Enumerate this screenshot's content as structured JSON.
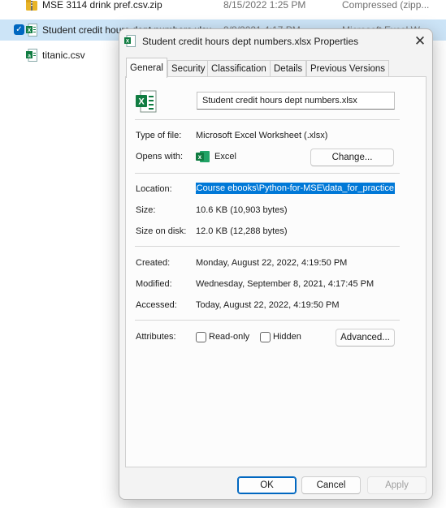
{
  "explorer": {
    "files": [
      {
        "name": "MSE 3114 drink pref.csv.zip",
        "date": "8/15/2022 1:25 PM",
        "type": "Compressed (zipp..."
      },
      {
        "name": "Student credit hours dept numbers.xlsx",
        "date": "9/8/2021 4:17 PM",
        "type": "Microsoft Excel W..."
      },
      {
        "name": "titanic.csv",
        "date": "",
        "type": ""
      }
    ],
    "checkmark": "✓"
  },
  "dialog": {
    "title": "Student credit hours dept numbers.xlsx Properties",
    "close_glyph": "✕",
    "tabs": [
      "General",
      "Security",
      "Classification",
      "Details",
      "Previous Versions"
    ],
    "filename_value": "Student credit hours dept numbers.xlsx",
    "type_label": "Type of file:",
    "type_value": "Microsoft Excel Worksheet (.xlsx)",
    "opens_label": "Opens with:",
    "opens_value": "Excel",
    "change_label": "Change...",
    "location_label": "Location:",
    "location_value": "\\Course ebooks\\Python-for-MSE\\data_for_practice",
    "size_label": "Size:",
    "size_value": "10.6 KB (10,903 bytes)",
    "disk_label": "Size on disk:",
    "disk_value": "12.0 KB (12,288 bytes)",
    "created_label": "Created:",
    "created_value": "Monday, August 22, 2022, 4:19:50 PM",
    "modified_label": "Modified:",
    "modified_value": "Wednesday, September 8, 2021, 4:17:45 PM",
    "accessed_label": "Accessed:",
    "accessed_value": "Today, August 22, 2022, 4:19:50 PM",
    "attributes_label": "Attributes:",
    "readonly_label": "Read-only",
    "hidden_label": "Hidden",
    "advanced_label": "Advanced...",
    "ok_label": "OK",
    "cancel_label": "Cancel",
    "apply_label": "Apply"
  },
  "colors": {
    "accent": "#0067c0",
    "selection": "#0078d7",
    "row_selected": "#cce4f7",
    "excel_green": "#107c41"
  }
}
